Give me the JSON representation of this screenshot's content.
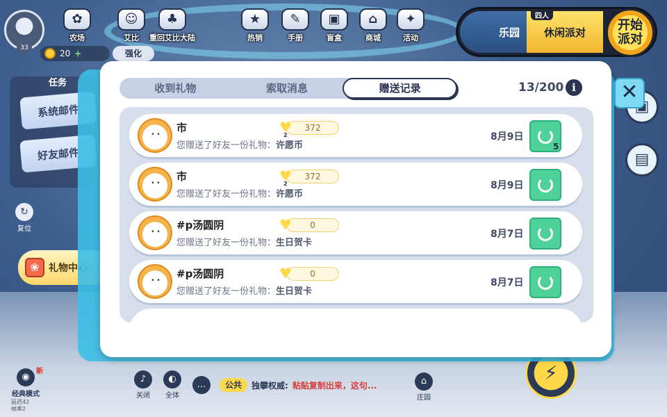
{
  "hud": {
    "player_level": "33",
    "coins": "20",
    "enhance_label": "强化",
    "top_nav": [
      {
        "label": "农场",
        "icon": "farm-icon",
        "glyph": "✿"
      },
      {
        "label": "艾比",
        "icon": "cat-icon",
        "glyph": "☺"
      },
      {
        "label": "重回艾比大陆",
        "icon": "bear-icon",
        "glyph": "♣"
      },
      {
        "label": "热销",
        "icon": "hot-sale-icon",
        "glyph": "★"
      },
      {
        "label": "手册",
        "icon": "handbook-icon",
        "glyph": "✎"
      },
      {
        "label": "盲盒",
        "icon": "blind-box-icon",
        "glyph": "▣"
      },
      {
        "label": "商城",
        "icon": "mall-icon",
        "glyph": "⌂"
      },
      {
        "label": "活动",
        "icon": "event-icon",
        "glyph": "✦"
      }
    ],
    "mode_left": "乐园",
    "mode_tag": "四人",
    "mode_name": "休闲派对",
    "start_label": "开始派对",
    "task_label": "任务",
    "reset_label": "复位",
    "side_tabs": [
      "系统邮件",
      "好友邮件"
    ],
    "gift_center": "礼物中心",
    "classic_mode": "经典模式",
    "new_badge": "新",
    "stats_line1": "延迟42",
    "stats_line2": "帧率2",
    "bottom": {
      "mute": "关闭",
      "all": "全体",
      "chat_tag": "公共",
      "chat_user": "独攀权威:",
      "chat_msg": "粘贴复制出来，这句...",
      "home": "庄园"
    }
  },
  "modal": {
    "tabs": [
      "收到礼物",
      "索取消息",
      "赠送记录"
    ],
    "active_tab": 2,
    "count": "13/200",
    "info_glyph": "i",
    "close_glyph": "✕",
    "rows": [
      {
        "name": "市",
        "desc_prefix": "您赠送了好友一份礼物：",
        "item": "许愿币",
        "intimacy": "372",
        "heart_level": "2",
        "date": "8月9日",
        "status_count": "5"
      },
      {
        "name": "市",
        "desc_prefix": "您赠送了好友一份礼物：",
        "item": "许愿币",
        "intimacy": "372",
        "heart_level": "2",
        "date": "8月9日",
        "status_count": ""
      },
      {
        "name": "#p汤圆阴",
        "desc_prefix": "您赠送了好友一份礼物：",
        "item": "生日贺卡",
        "intimacy": "0",
        "heart_level": "",
        "date": "8月7日",
        "status_count": ""
      },
      {
        "name": "#p汤圆阴",
        "desc_prefix": "您赠送了好友一份礼物：",
        "item": "生日贺卡",
        "intimacy": "0",
        "heart_level": "",
        "date": "8月7日",
        "status_count": ""
      }
    ]
  },
  "colors": {
    "modal_border": "#3cbee6",
    "status_green": "#4fd29a",
    "tab_active_border": "#2b3552"
  }
}
